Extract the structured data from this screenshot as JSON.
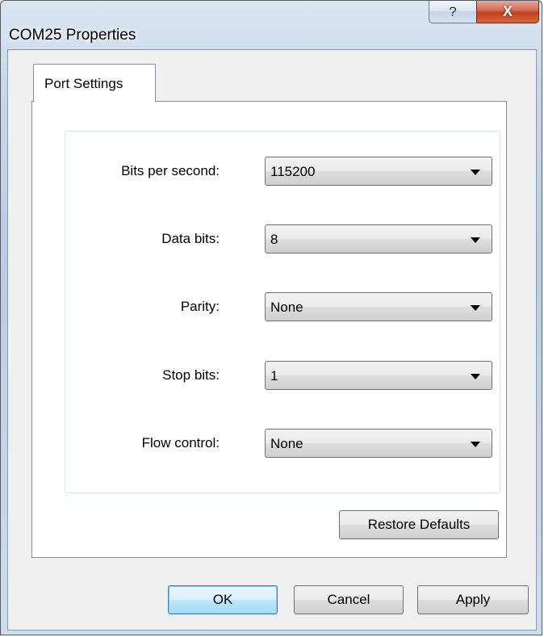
{
  "window": {
    "title": "COM25 Properties",
    "help_glyph": "?",
    "close_glyph": "X"
  },
  "tabs": [
    {
      "label": "Port Settings",
      "selected": true
    }
  ],
  "settings": [
    {
      "label": "Bits per second:",
      "value": "115200"
    },
    {
      "label": "Data bits:",
      "value": "8"
    },
    {
      "label": "Parity:",
      "value": "None"
    },
    {
      "label": "Stop bits:",
      "value": "1"
    },
    {
      "label": "Flow control:",
      "value": "None"
    }
  ],
  "buttons": {
    "restore_defaults": "Restore Defaults",
    "ok": "OK",
    "cancel": "Cancel",
    "apply": "Apply"
  },
  "icons": {
    "help": "help-icon",
    "close": "close-icon",
    "dropdown": "chevron-down-icon"
  },
  "colors": {
    "close_button": "#c2401f",
    "default_button_border": "#3c7fb1",
    "frame": "#b9cde5"
  }
}
